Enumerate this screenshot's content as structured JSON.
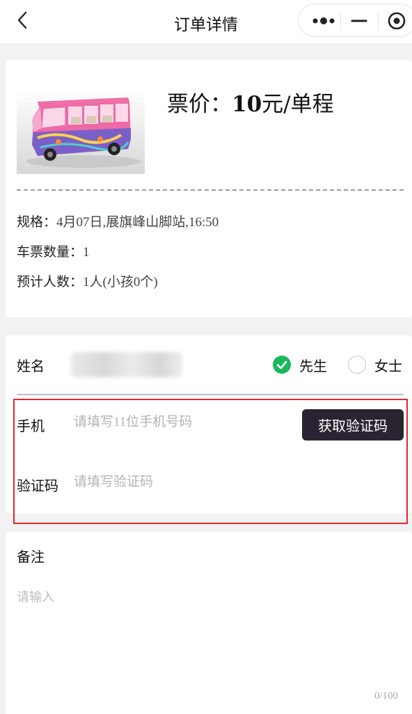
{
  "nav": {
    "title": "订单详情",
    "icons": {
      "back": "chevron-left-icon",
      "more": "more-dots-icon",
      "minimize": "minimize-icon",
      "close": "target-circle-icon"
    }
  },
  "order": {
    "image": "pink-tour-bus",
    "price_prefix": "票价：",
    "price_amount": "10",
    "price_unit": "元/单程",
    "spec_label": "规格：",
    "spec_value": "4月07日,展旗峰山脚站,16:50",
    "count_label": "车票数量：",
    "count_value": "1",
    "people_label": "预计人数：",
    "people_value": "1人(小孩0个)"
  },
  "contact": {
    "name_label": "姓名",
    "gender_options": [
      {
        "label": "先生",
        "selected": true
      },
      {
        "label": "女士",
        "selected": false
      }
    ],
    "phone_label": "手机",
    "phone_placeholder": "请填写11位手机号码",
    "sms_button": "获取验证码",
    "code_label": "验证码",
    "code_placeholder": "请填写验证码"
  },
  "note": {
    "label": "备注",
    "placeholder": "请输入",
    "counter": "0/100"
  },
  "colors": {
    "page_bg": "#f2f2f2",
    "accent_green": "#1ab75b",
    "button_dark": "#2a2432",
    "highlight_red": "#e0292c"
  }
}
